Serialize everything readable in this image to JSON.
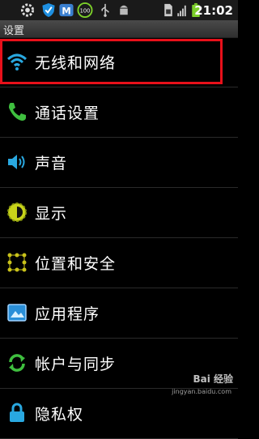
{
  "status_bar": {
    "time": "21:02",
    "icons": [
      "settings-icon",
      "shield-icon",
      "m-app-icon",
      "battery-100-icon",
      "usb-icon",
      "android-debug-icon",
      "sim-icon",
      "signal-icon",
      "battery-icon"
    ],
    "battery_badge": "100"
  },
  "title_bar": {
    "title": "设置"
  },
  "settings_list": [
    {
      "label": "无线和网络",
      "icon": "wifi-icon"
    },
    {
      "label": "通话设置",
      "icon": "phone-icon"
    },
    {
      "label": "声音",
      "icon": "speaker-icon"
    },
    {
      "label": "显示",
      "icon": "brightness-icon"
    },
    {
      "label": "位置和安全",
      "icon": "location-grid-icon"
    },
    {
      "label": "应用程序",
      "icon": "applications-icon"
    },
    {
      "label": "帐户与同步",
      "icon": "sync-icon"
    },
    {
      "label": "隐私权",
      "icon": "privacy-icon"
    }
  ],
  "watermark": {
    "text": "Bai 经验",
    "sub": "jingyan.baidu.com"
  },
  "colors": {
    "highlight": "#e8101a",
    "wifi": "#29a8e0",
    "phone": "#3fbf3f",
    "sync": "#3fbf3f"
  }
}
